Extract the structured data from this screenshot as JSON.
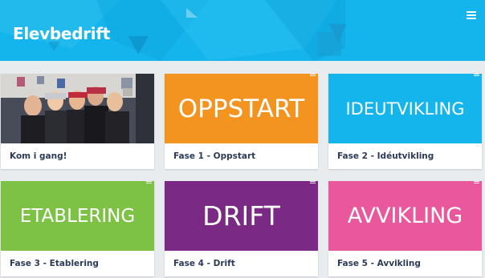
{
  "header": {
    "title": "Elevbedrift",
    "menu_icon": "hamburger-menu-icon",
    "color": "#14b4ec"
  },
  "cards": [
    {
      "tile_text": "",
      "caption": "Kom i gang!",
      "color": "#3a3f4a",
      "image": "group-photo-students"
    },
    {
      "tile_text": "OPPSTART",
      "caption": "Fase 1 - Oppstart",
      "color": "#f39421"
    },
    {
      "tile_text": "IDEUTVIKLING",
      "caption": "Fase 2 - Idéutvikling",
      "color": "#14b4ec"
    },
    {
      "tile_text": "ETABLERING",
      "caption": "Fase 3 - Etablering",
      "color": "#7dc244"
    },
    {
      "tile_text": "DRIFT",
      "caption": "Fase 4 - Drift",
      "color": "#7a2a85"
    },
    {
      "tile_text": "AVVIKLING",
      "caption": "Fase 5 - Avvikling",
      "color": "#e9579c"
    }
  ]
}
